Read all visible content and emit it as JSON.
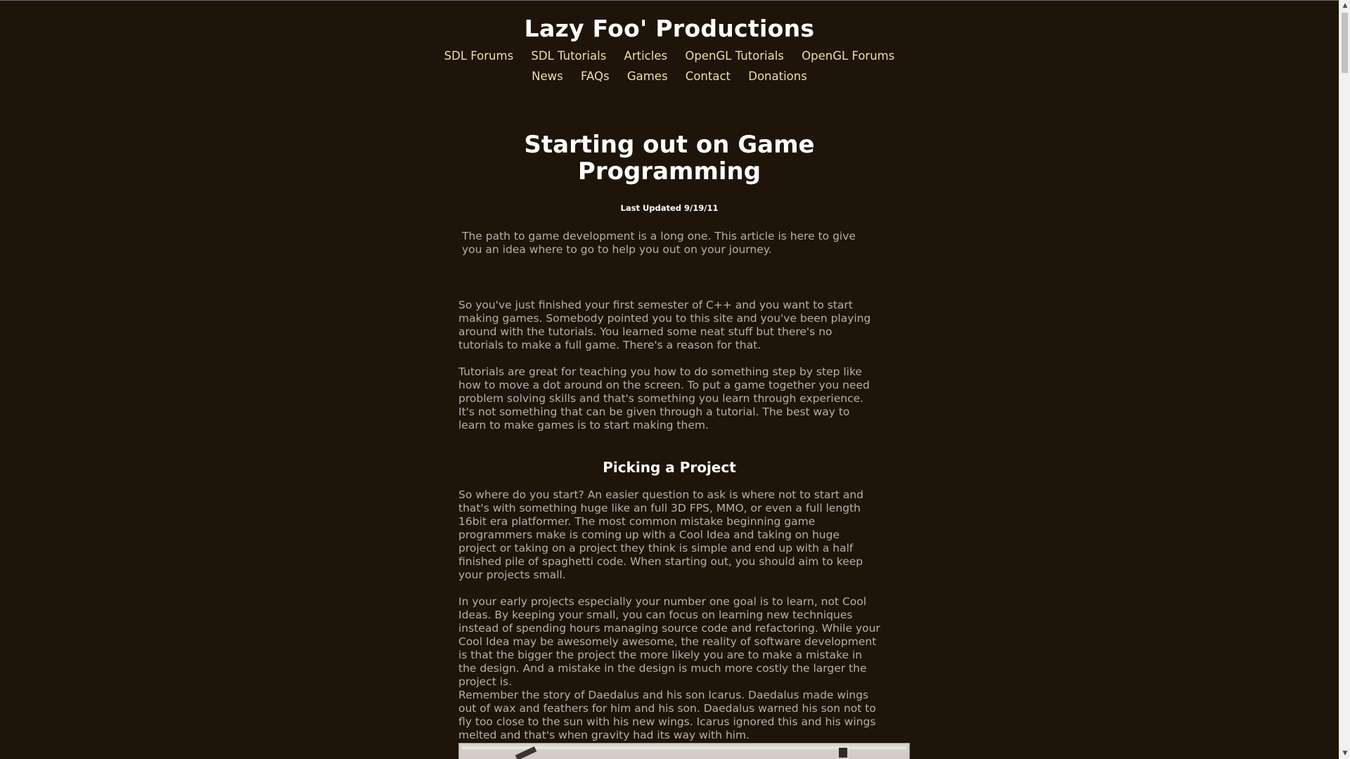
{
  "header": {
    "site_title": "Lazy Foo' Productions",
    "nav_row1": [
      "SDL Forums",
      "SDL Tutorials",
      "Articles",
      "OpenGL Tutorials",
      "OpenGL Forums"
    ],
    "nav_row2": [
      "News",
      "FAQs",
      "Games",
      "Contact",
      "Donations"
    ]
  },
  "article": {
    "title_line1": "Starting out on Game",
    "title_line2": "Programming",
    "updated": "Last Updated 9/19/11",
    "intro": "The path to game development is a long one. This article is here to give you an idea where to go to help you out on your journey.",
    "p1": "So you've just finished your first semester of C++ and you want to start making games. Somebody pointed you to this site and you've been playing around with the tutorials. You learned some neat stuff but there's no tutorials to make a full game. There's a reason for that.",
    "p2": "Tutorials are great for teaching you how to do something step by step like how to move a dot around on the screen. To put a game together you need problem solving skills and that's something you learn through experience. It's not something that can be given through a tutorial. The best way to learn to make games is to start making them.",
    "section1_heading": "Picking a Project",
    "p3": "So where do you start? An easier question to ask is where not to start and that's with something huge like an full 3D FPS, MMO, or even a full length 16bit era platformer. The most common mistake beginning game programmers make is coming up with a Cool Idea and taking on huge project or taking on a project they think is simple and end up with a half finished pile of spaghetti code. When starting out, you should aim to keep your projects small.",
    "p4": "In your early projects especially your number one goal is to learn, not Cool Ideas. By keeping your small, you can focus on learning new techniques instead of spending hours managing source code and refactoring. While your Cool Idea may be awesomely awesome, the reality of software development is that the bigger the project the more likely you are to make a mistake in the design. And a mistake in the design is much more costly the larger the project is.",
    "p5": "Remember the story of Daedalus and his son Icarus. Daedalus made wings out of wax and feathers for him and his son. Daedalus warned his son not to fly too close to the sun with his new wings. Icarus ignored this and his wings melted and that's when gravity had its way with him."
  },
  "scrollbar": {
    "up_icon": "▲",
    "down_icon": "▼"
  }
}
